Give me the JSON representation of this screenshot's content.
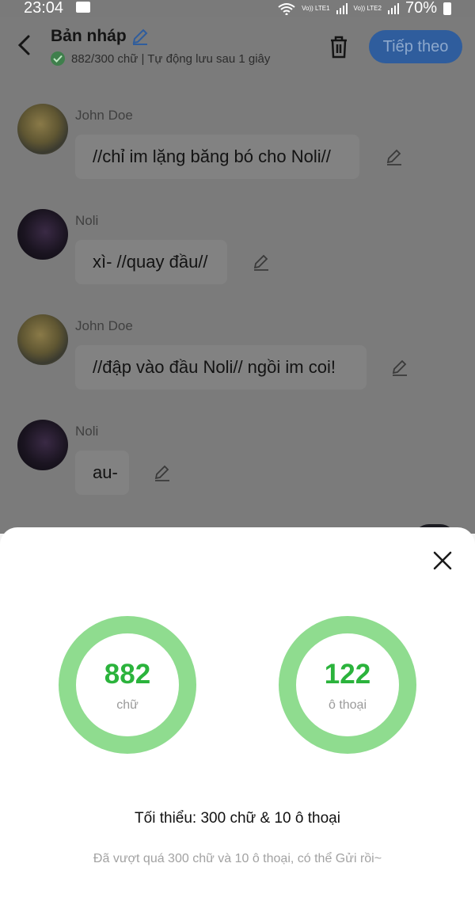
{
  "status_bar": {
    "time": "23:04",
    "sim1_label": "Vo)) LTE1",
    "sim2_label": "Vo)) LTE2",
    "battery": "70%"
  },
  "header": {
    "title": "Bản nháp",
    "subtitle": "882/300 chữ | Tự động lưu sau 1 giây",
    "next_label": "Tiếp theo",
    "accent_color": "#2f5d9d"
  },
  "messages": [
    {
      "sender": "John Doe",
      "text": "//chỉ im lặng băng bó cho Noli//",
      "avatar": "avatar-john"
    },
    {
      "sender": "Noli",
      "text": "xì- //quay đầu//",
      "avatar": "avatar-noli"
    },
    {
      "sender": "John Doe",
      "text": "//đập vào đầu Noli// ngồi im coi!",
      "avatar": "avatar-john"
    },
    {
      "sender": "Noli",
      "text": "au-",
      "avatar": "avatar-noli"
    }
  ],
  "stats_sheet": {
    "words_count": "882",
    "words_label": "chữ",
    "dialogs_count": "122",
    "dialogs_label": "ô thoại",
    "minimum": "Tối thiểu: 300 chữ & 10 ô thoại",
    "note": "Đã vượt quá 300 chữ và 10 ô thoại, có thể Gửi rồi~",
    "ring_color": "#8fdc8f",
    "number_color": "#2bb33c"
  },
  "icons": [
    "chat-bubble-icon",
    "wifi-icon",
    "signal-icon",
    "battery-icon",
    "back-arrow-icon",
    "pencil-icon",
    "check-icon",
    "trash-icon",
    "edit-icon",
    "close-icon"
  ]
}
